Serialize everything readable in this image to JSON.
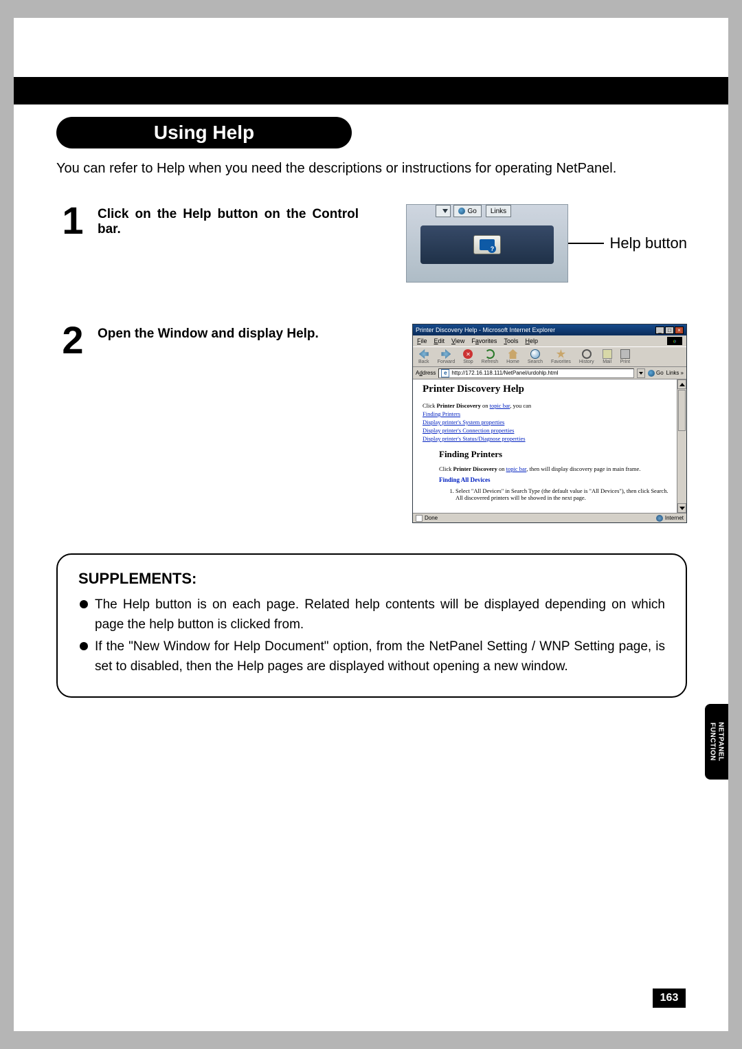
{
  "heading": "Using Help",
  "intro": "You can refer to Help when you need the descriptions or instructions for operating NetPanel.",
  "steps": {
    "one": {
      "num": "1",
      "text": "Click on the Help button on the Control bar."
    },
    "two": {
      "num": "2",
      "text": "Open the Window and display Help."
    }
  },
  "shot1": {
    "go": "Go",
    "links": "Links",
    "callout": "Help button"
  },
  "shot2": {
    "title": "Printer Discovery Help - Microsoft Internet Explorer",
    "menu": {
      "file": "File",
      "edit": "Edit",
      "view": "View",
      "favorites": "Favorites",
      "tools": "Tools",
      "help": "Help"
    },
    "toolbar": {
      "back": "Back",
      "forward": "Forward",
      "stop": "Stop",
      "refresh": "Refresh",
      "home": "Home",
      "search": "Search",
      "favorites": "Favorites",
      "history": "History",
      "mail": "Mail",
      "print": "Print"
    },
    "addressLabel": "Address",
    "addressValue": "http://172.16.118.111/NetPanel/urdohlp.html",
    "go": "Go",
    "links": "Links",
    "h2": "Printer Discovery Help",
    "clickLine_a": "Click ",
    "clickLine_b": "Printer Discovery",
    "clickLine_c": " on ",
    "clickLine_d": "topic bar",
    "clickLine_e": ", you can",
    "link1": "Finding Printers",
    "link2": "Display printer's System properties",
    "link3": "Display printer's Connection properties",
    "link4": "Display printer's Status/Diagnose properties",
    "h3": "Finding Printers",
    "para_a": "Click ",
    "para_b": "Printer Discovery",
    "para_c": " on ",
    "para_d": "topic bar",
    "para_e": ", then will display discovery page in main frame.",
    "findAll": "Finding All Devices",
    "ol1": "Select \"All Devices\" in Search Type (the default value is \"All Devices\"), then click Search. All discovered printers will be showed in the next page.",
    "statusDone": "Done",
    "statusZone": "Internet"
  },
  "supplements": {
    "title": "SUPPLEMENTS:",
    "items": [
      "The Help button is on each page.  Related help contents will be displayed depending on which page the help button is clicked from.",
      "If the \"New Window for Help Document\" option, from the NetPanel Setting / WNP Setting page, is set to disabled, then the Help pages are displayed without opening a new window."
    ]
  },
  "sideTab": {
    "line1": "NETPANEL",
    "line2": "FUNCTION"
  },
  "pageNumber": "163"
}
